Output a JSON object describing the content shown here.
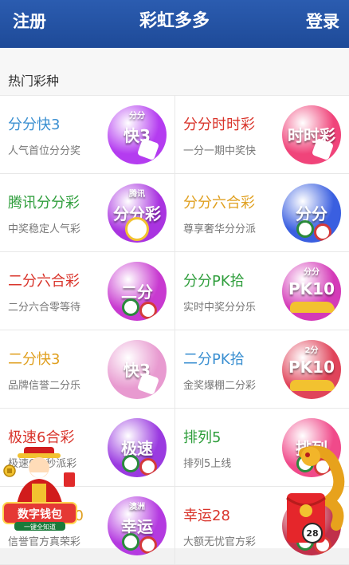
{
  "header": {
    "left": "注册",
    "title": "彩虹多多",
    "right": "登录"
  },
  "section": {
    "title": "热门彩种"
  },
  "games": [
    {
      "name": "分分快3",
      "desc": "人气首位分分奖",
      "color": "#3a8fd1",
      "badge_top": "分分",
      "badge_main": "快3",
      "badge_bg": "#b43cf0",
      "badge_icon": "dice-icon"
    },
    {
      "name": "分分时时彩",
      "desc": "一分一期中奖快",
      "color": "#d9342b",
      "badge_top": "",
      "badge_main": "时时彩",
      "badge_bg": "#f0447a",
      "badge_icon": "dice-icon"
    },
    {
      "name": "腾讯分分彩",
      "desc": "中奖稳定人气彩",
      "color": "#2f9e3c",
      "badge_top": "腾讯",
      "badge_main": "分分彩",
      "badge_bg": "#a934e0",
      "badge_icon": "alarm-clock-icon"
    },
    {
      "name": "分分六合彩",
      "desc": "尊享奢华分分派",
      "color": "#e0a020",
      "badge_top": "",
      "badge_main": "分分",
      "badge_bg": "#3a5fe0",
      "badge_icon": "lottery-balls-icon"
    },
    {
      "name": "二分六合彩",
      "desc": "二分六合零等待",
      "color": "#d9342b",
      "badge_top": "",
      "badge_main": "二分",
      "badge_bg": "#c83ad0",
      "badge_icon": "lottery-balls-icon"
    },
    {
      "name": "分分PK拾",
      "desc": "实时中奖分分乐",
      "color": "#2f9e3c",
      "badge_top": "分分",
      "badge_main": "PK10",
      "badge_bg": "#d43ab8",
      "badge_icon": "race-car-icon"
    },
    {
      "name": "二分快3",
      "desc": "品牌信誉二分乐",
      "color": "#e0a020",
      "badge_top": "",
      "badge_main": "快3",
      "badge_bg": "#e89ad0",
      "badge_icon": "dice-icon"
    },
    {
      "name": "二分PK拾",
      "desc": "金奖爆棚二分彩",
      "color": "#3a8fd1",
      "badge_top": "2分",
      "badge_main": "PK10",
      "badge_bg": "#e0445a",
      "badge_icon": "race-car-icon"
    },
    {
      "name": "极速6合彩",
      "desc": "极速6合秒派彩",
      "color": "#d9342b",
      "badge_top": "",
      "badge_main": "极速",
      "badge_bg": "#9a3ae0",
      "badge_icon": "lottery-balls-icon"
    },
    {
      "name": "排列5",
      "desc": "排列5上线",
      "color": "#2f9e3c",
      "badge_top": "",
      "badge_main": "排列",
      "badge_bg": "#f04a8a",
      "badge_icon": "lottery-balls-icon"
    },
    {
      "name": "澳洲幸运10",
      "desc": "信誉官方真荣彩",
      "color": "#e0a020",
      "badge_top": "澳洲",
      "badge_main": "幸运",
      "badge_bg": "#b43ae0",
      "badge_icon": "lottery-balls-icon"
    },
    {
      "name": "幸运28",
      "desc": "大额无忧官方彩",
      "color": "#d9342b",
      "badge_top": "",
      "badge_main": "28",
      "badge_bg": "#c0304a",
      "badge_icon": "lottery-balls-icon"
    }
  ],
  "promo_left": {
    "title": "数字钱包",
    "subtitle": "一键全知道",
    "icon": "god-of-wealth-icon"
  },
  "promo_right": {
    "icon": "red-envelope-dragon-icon",
    "number": "28"
  }
}
